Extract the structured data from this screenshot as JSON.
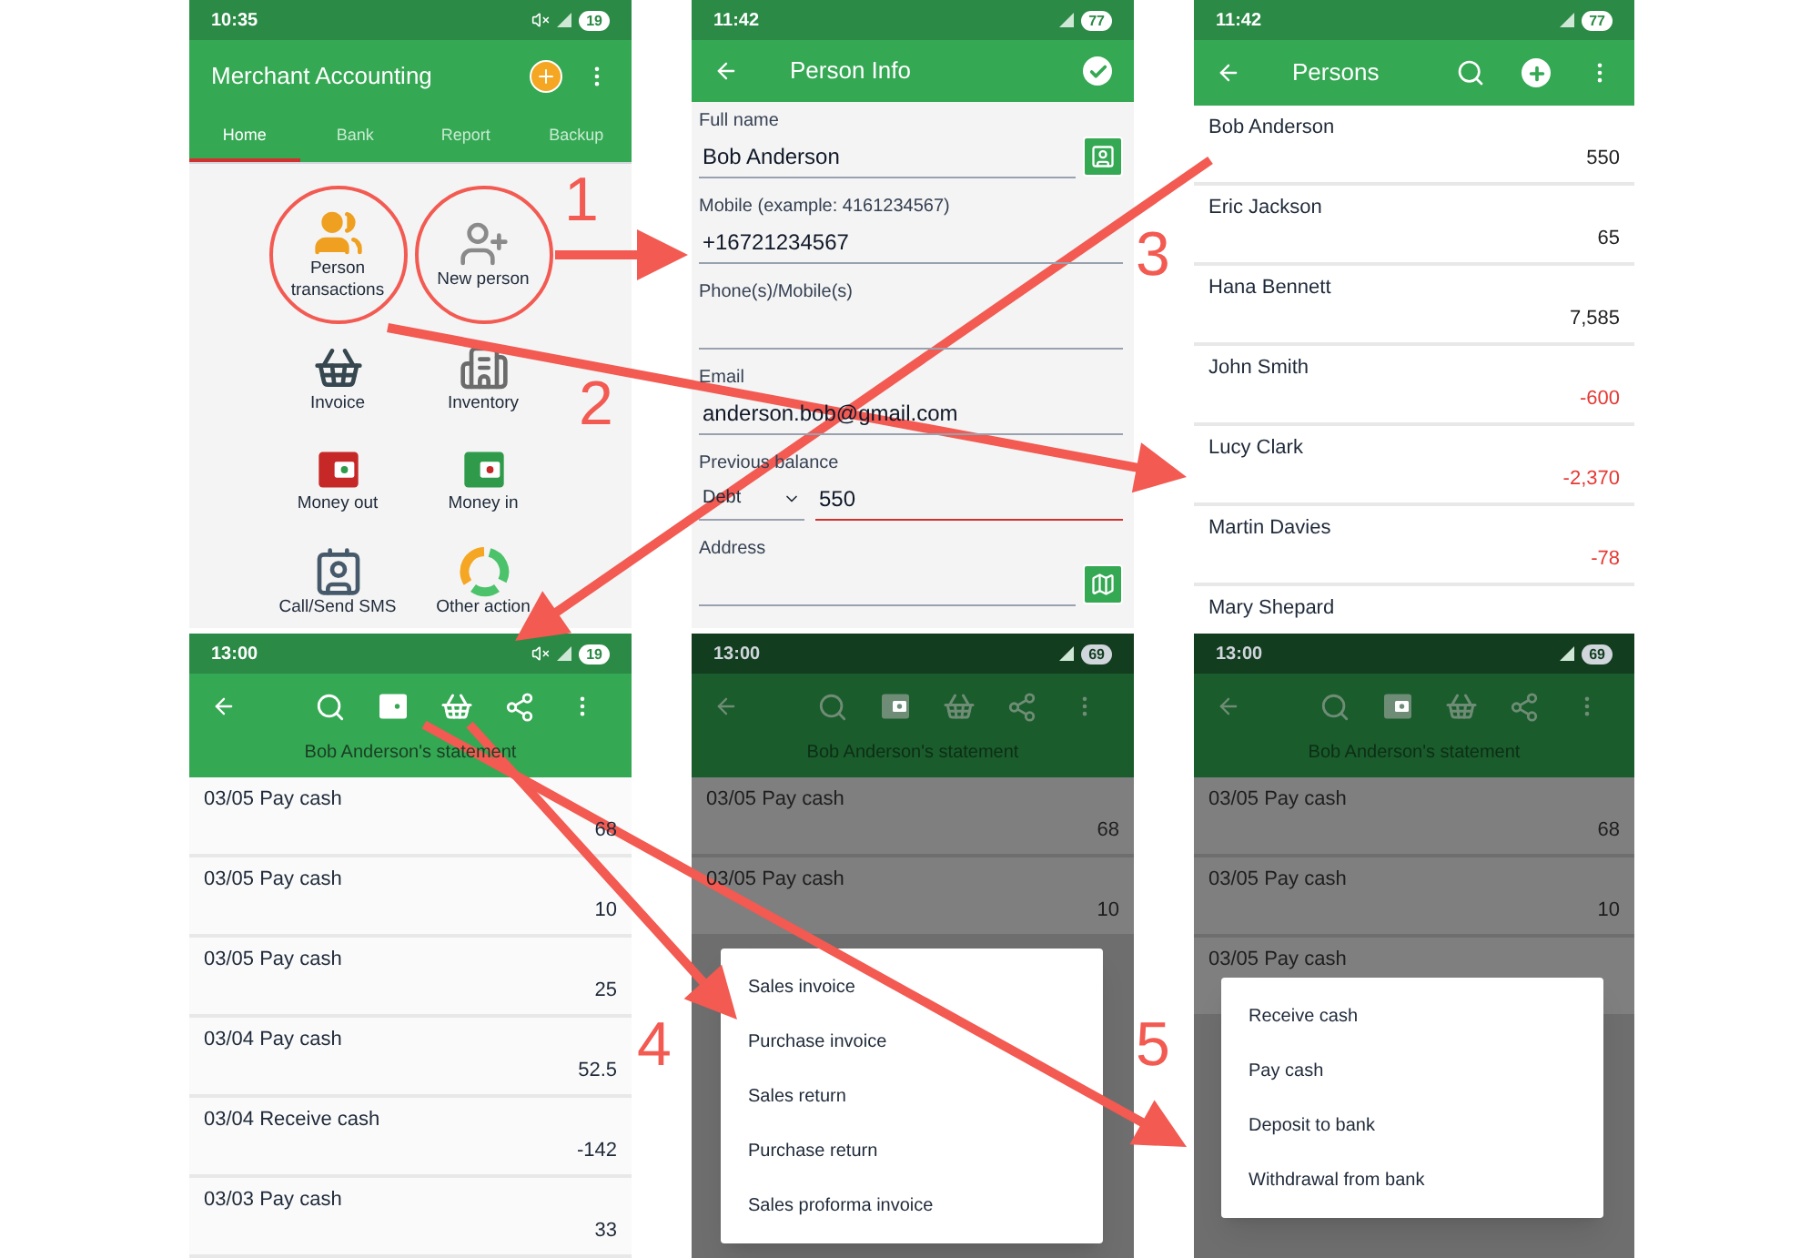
{
  "screens": [
    {
      "kind": "home",
      "status": {
        "time": "10:35",
        "battery": "19",
        "muted": true
      },
      "title": "Merchant Accounting",
      "tabs": [
        {
          "label": "Home",
          "selected": true
        },
        {
          "label": "Bank",
          "selected": false
        },
        {
          "label": "Report",
          "selected": false
        },
        {
          "label": "Backup",
          "selected": false
        }
      ],
      "actions": [
        {
          "label": "Person transactions",
          "circled": true
        },
        {
          "label": "New person",
          "circled": true
        },
        {
          "label": "Invoice",
          "circled": false
        },
        {
          "label": "Inventory",
          "circled": false
        },
        {
          "label": "Money out",
          "circled": false
        },
        {
          "label": "Money in",
          "circled": false
        },
        {
          "label": "Call/Send SMS",
          "circled": false
        },
        {
          "label": "Other action",
          "circled": false
        }
      ]
    },
    {
      "kind": "person_info",
      "status": {
        "time": "11:42",
        "battery": "77",
        "muted": false
      },
      "title": "Person Info",
      "fields": [
        {
          "kind": "contact",
          "label": "Full name",
          "value": "Bob Anderson",
          "focused": false
        },
        {
          "kind": "plain",
          "label": "Mobile (example: 4161234567)",
          "value": "+16721234567",
          "focused": false
        },
        {
          "kind": "plain",
          "label": "Phone(s)/Mobile(s)",
          "focused": false
        },
        {
          "kind": "plain",
          "label": "Email",
          "value": "anderson.bob@gmail.com",
          "focused": false
        },
        {
          "kind": "balance",
          "label": "Previous balance",
          "option": "Debt",
          "value": "550",
          "focused": true
        },
        {
          "kind": "map",
          "label": "Address",
          "focused": false
        }
      ]
    },
    {
      "kind": "persons",
      "status": {
        "time": "11:42",
        "battery": "77",
        "muted": false
      },
      "title": "Persons",
      "rows": [
        {
          "name": "Bob Anderson",
          "amount": "550",
          "negative": false
        },
        {
          "name": "Eric Jackson",
          "amount": "65",
          "negative": false
        },
        {
          "name": "Hana Bennett",
          "amount": "7,585",
          "negative": false
        },
        {
          "name": "John Smith",
          "amount": "-600",
          "negative": true
        },
        {
          "name": "Lucy Clark",
          "amount": "-2,370",
          "negative": true
        },
        {
          "name": "Martin Davies",
          "amount": "-78",
          "negative": true
        },
        {
          "name": "Mary Shepard"
        }
      ]
    },
    {
      "kind": "statement",
      "status": {
        "time": "13:00",
        "battery": "19",
        "muted": true
      },
      "subtitle": "Bob Anderson's statement",
      "rows": [
        {
          "label": "03/05 Pay cash",
          "amount": "68"
        },
        {
          "label": "03/05 Pay cash",
          "amount": "10"
        },
        {
          "label": "03/05 Pay cash",
          "amount": "25"
        },
        {
          "label": "03/04 Pay cash",
          "amount": "52.5"
        },
        {
          "label": "03/04 Receive cash",
          "amount": "-142"
        },
        {
          "label": "03/03 Pay cash",
          "amount": "33"
        }
      ]
    },
    {
      "kind": "statement",
      "status": {
        "time": "13:00",
        "battery": "69",
        "muted": false
      },
      "subtitle": "Bob Anderson's statement",
      "rows": [
        {
          "label": "03/05 Pay cash",
          "amount": "68"
        },
        {
          "label": "03/05 Pay cash",
          "amount": "10"
        }
      ],
      "menu": {
        "kind": "invoice",
        "items": [
          "Sales invoice",
          "Purchase invoice",
          "Sales return",
          "Purchase return",
          "Sales proforma invoice"
        ]
      }
    },
    {
      "kind": "statement",
      "status": {
        "time": "13:00",
        "battery": "69",
        "muted": false
      },
      "subtitle": "Bob Anderson's statement",
      "rows": [
        {
          "label": "03/05 Pay cash",
          "amount": "68"
        },
        {
          "label": "03/05 Pay cash",
          "amount": "10"
        },
        {
          "label": "03/05 Pay cash"
        }
      ],
      "menu": {
        "kind": "cash",
        "items": [
          "Receive cash",
          "Pay cash",
          "Deposit to bank",
          "Withdrawal from bank"
        ]
      }
    }
  ],
  "steps": [
    "1",
    "2",
    "3",
    "4",
    "5"
  ]
}
